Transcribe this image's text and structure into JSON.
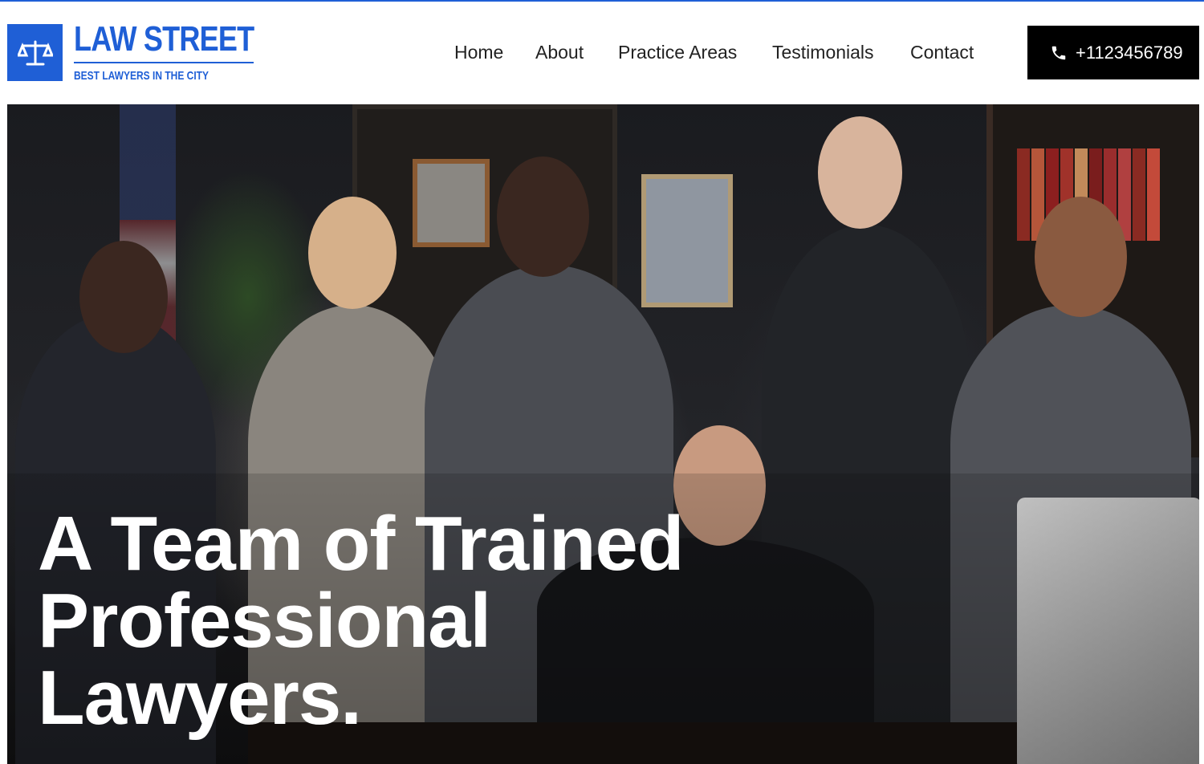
{
  "brand": {
    "name": "LAW STREET",
    "tagline": "BEST LAWYERS IN THE CITY",
    "logo_icon": "scales-of-justice-icon",
    "accent_color": "#1f5fd6"
  },
  "nav": {
    "items": [
      {
        "label": "Home"
      },
      {
        "label": "About"
      },
      {
        "label": "Practice Areas"
      },
      {
        "label": "Testimonials"
      },
      {
        "label": "Contact"
      }
    ]
  },
  "cta": {
    "phone": "+1123456789",
    "icon": "phone-icon",
    "background": "#000000"
  },
  "hero": {
    "title_lines": [
      "A Team of Trained",
      "Professional",
      "Lawyers."
    ],
    "image_alt": "group of lawyers in office"
  }
}
